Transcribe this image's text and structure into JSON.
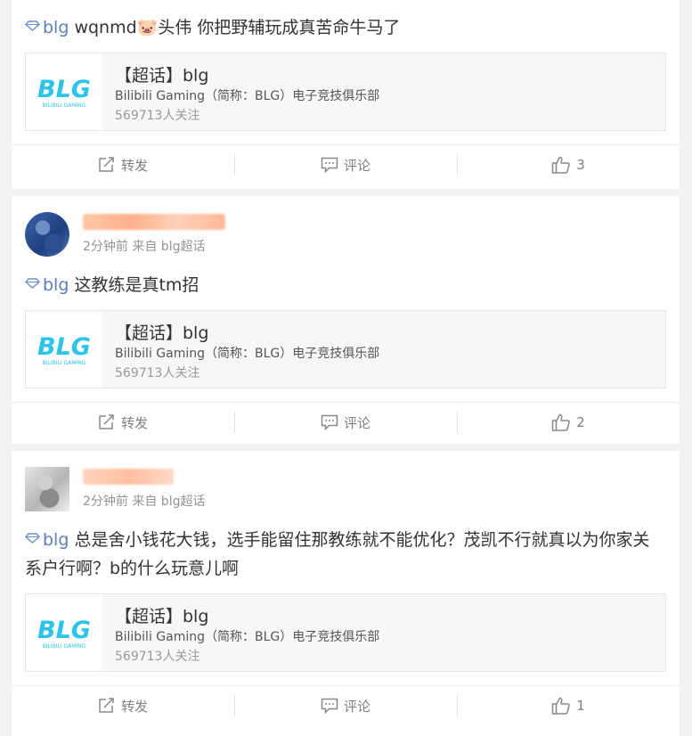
{
  "posts": [
    {
      "has_header": false,
      "tag": "blg",
      "text_before": " wqnmd",
      "emoji": "🐷",
      "text_after": "头伟 你把野辅玩成真苦命牛马了",
      "topic": {
        "title": "【超话】blg",
        "description": "Bilibili Gaming（简称：BLG）电子竞技俱乐部",
        "followers": "569713人关注",
        "logo_text": "BLG",
        "logo_subtext": "BILIBILI GAMING"
      },
      "actions": {
        "repost": "转发",
        "comment": "评论",
        "like_count": "3"
      }
    },
    {
      "has_header": true,
      "meta": "2分钟前 来自 blg超话",
      "tag": "blg",
      "text": " 这教练是真tm招",
      "topic": {
        "title": "【超话】blg",
        "description": "Bilibili Gaming（简称：BLG）电子竞技俱乐部",
        "followers": "569713人关注",
        "logo_text": "BLG",
        "logo_subtext": "BILIBILI GAMING"
      },
      "actions": {
        "repost": "转发",
        "comment": "评论",
        "like_count": "2"
      }
    },
    {
      "has_header": true,
      "meta": "2分钟前 来自 blg超话",
      "tag": "blg",
      "text": " 总是舍小钱花大钱，选手能留住那教练就不能优化？茂凯不行就真以为你家关系户行啊？b的什么玩意儿啊",
      "topic": {
        "title": "【超话】blg",
        "description": "Bilibili Gaming（简称：BLG）电子竞技俱乐部",
        "followers": "569713人关注",
        "logo_text": "BLG",
        "logo_subtext": "BILIBILI GAMING"
      },
      "actions": {
        "repost": "转发",
        "comment": "评论",
        "like_count": "1"
      }
    }
  ],
  "colors": {
    "tag": "#5d7fb5",
    "logo": "#2ec4e8",
    "username_blur": "#ffb08a"
  }
}
